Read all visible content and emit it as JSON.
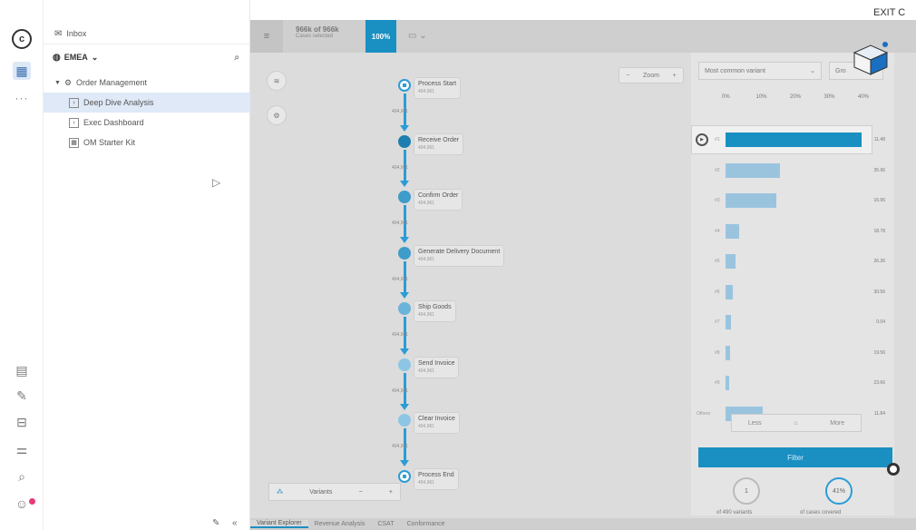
{
  "exit_label": "EXIT C",
  "tree": {
    "inbox_label": "Inbox",
    "workspace_label": "EMEA",
    "root_label": "Order Management",
    "items": [
      {
        "label": "Deep Dive Analysis",
        "selected": true
      },
      {
        "label": "Exec Dashboard",
        "selected": false
      },
      {
        "label": "OM Starter Kit",
        "selected": false
      }
    ]
  },
  "topbar": {
    "cases_count": "966k of 966k",
    "cases_sub": "Cases selected",
    "percent": "100%"
  },
  "zoom": {
    "minus": "−",
    "label": "Zoom",
    "plus": "+"
  },
  "process": {
    "nodes": [
      {
        "label": "Process Start",
        "count": "404,961",
        "shape": "start"
      },
      {
        "label": "Receive Order",
        "count": "404,961",
        "shape": "dark"
      },
      {
        "label": "Confirm Order",
        "count": "404,961",
        "shape": "mid"
      },
      {
        "label": "Generate Delivery Document",
        "count": "404,961",
        "shape": "mid"
      },
      {
        "label": "Ship Goods",
        "count": "404,961",
        "shape": "light"
      },
      {
        "label": "Send Invoice",
        "count": "404,961",
        "shape": "lighter"
      },
      {
        "label": "Clear Invoice",
        "count": "404,961",
        "shape": "lighter"
      },
      {
        "label": "Process End",
        "count": "404,961",
        "shape": "end"
      }
    ],
    "edge_counts": [
      "404,961",
      "404,961",
      "404,961",
      "404,961",
      "404,961",
      "404,961",
      "404,961"
    ]
  },
  "variants_panel": {
    "select_label": "Most common variant",
    "group_label": "Gro",
    "ticks": [
      "0%",
      "10%",
      "20%",
      "30%",
      "40%"
    ],
    "rows": [
      {
        "label": "#1",
        "pct": 0.4,
        "value": "11.48"
      },
      {
        "label": "#2",
        "pct": 0.16,
        "value": "35.96"
      },
      {
        "label": "#3",
        "pct": 0.15,
        "value": "16.96"
      },
      {
        "label": "#4",
        "pct": 0.04,
        "value": "18.78"
      },
      {
        "label": "#5",
        "pct": 0.03,
        "value": "26.36"
      },
      {
        "label": "#6",
        "pct": 0.02,
        "value": "30.56"
      },
      {
        "label": "#7",
        "pct": 0.015,
        "value": "0.04"
      },
      {
        "label": "#8",
        "pct": 0.012,
        "value": "19.56"
      },
      {
        "label": "#9",
        "pct": 0.01,
        "value": "23.66"
      },
      {
        "label": "Others",
        "pct": 0.11,
        "value": "11.84"
      }
    ],
    "less_label": "Less",
    "more_label": "More",
    "filter_label": "Filter",
    "stat_variants_value": "1",
    "stat_variants_caption": "of 490 variants",
    "stat_cases_value": "41%",
    "stat_cases_caption": "of cases covered"
  },
  "variants_bar": {
    "label": "Variants",
    "minus": "−",
    "plus": "+"
  },
  "tabs": [
    {
      "label": "Variant Explorer",
      "active": true
    },
    {
      "label": "Revenue Analysis",
      "active": false
    },
    {
      "label": "CSAT",
      "active": false
    },
    {
      "label": "Conformance",
      "active": false
    }
  ],
  "colors": {
    "accent": "#1a8fc2",
    "edge": "#2c9cd6",
    "selected_bg": "#dfe9f7"
  }
}
